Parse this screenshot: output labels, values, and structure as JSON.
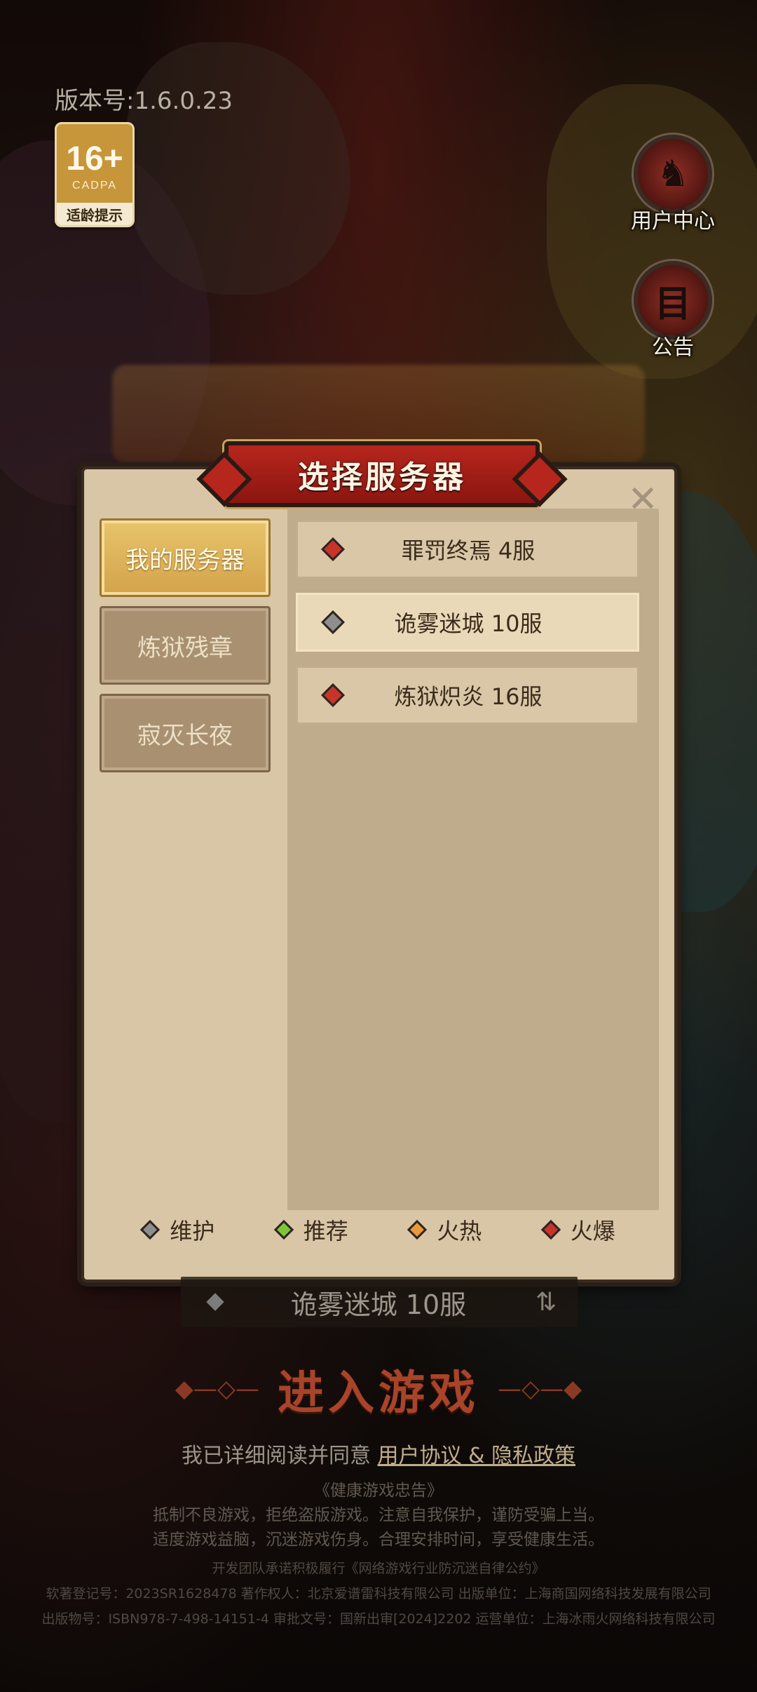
{
  "top": {
    "version": "版本号:1.6.0.23",
    "age_rating": {
      "age": "16+",
      "cadpa": "CADPA",
      "tip": "适龄提示"
    },
    "user_center": "用户中心",
    "announcement": "公告"
  },
  "dialog": {
    "title": "选择服务器",
    "close_icon": "✕",
    "tabs": [
      {
        "label": "我的服务器",
        "active": true
      },
      {
        "label": "炼狱残章",
        "active": false
      },
      {
        "label": "寂灭长夜",
        "active": false
      }
    ],
    "servers": [
      {
        "name": "罪罚终焉 4服",
        "status": "火爆",
        "selected": false
      },
      {
        "name": "诡雾迷城 10服",
        "status": "维护",
        "selected": true
      },
      {
        "name": "炼狱炽炎 16服",
        "status": "火爆",
        "selected": false
      }
    ],
    "legend": [
      {
        "label": "维护",
        "color": "#8e8e8e"
      },
      {
        "label": "推荐",
        "color": "#7cc63a"
      },
      {
        "label": "火热",
        "color": "#e89a38"
      },
      {
        "label": "火爆",
        "color": "#c8342a"
      }
    ]
  },
  "current_server": {
    "name": "诡雾迷城 10服",
    "swap_icon": "⇅"
  },
  "enter_button": "进入游戏",
  "agreement": {
    "prefix": "我已详细阅读并同意 ",
    "user_agreement": "用户协议",
    "and": " & ",
    "privacy_policy": "隐私政策"
  },
  "health": {
    "title": "《健康游戏忠告》",
    "line1": "抵制不良游戏，拒绝盗版游戏。注意自我保护，谨防受骗上当。",
    "line2": "适度游戏益脑，沉迷游戏伤身。合理安排时间，享受健康生活。"
  },
  "legal": {
    "line1": "开发团队承诺积极履行《网络游戏行业防沉迷自律公约》",
    "line2": "软著登记号：2023SR1628478 著作权人：北京爱谱雷科技有限公司 出版单位：上海商国网络科技发展有限公司",
    "line3": "出版物号：ISBN978-7-498-14151-4 审批文号：国新出审[2024]2202 运营单位：上海冰雨火网络科技有限公司"
  },
  "colors": {
    "status_maintenance": "#8e8e8e",
    "status_recommend": "#7cc63a",
    "status_hot": "#e89a38",
    "status_full": "#c8342a"
  }
}
